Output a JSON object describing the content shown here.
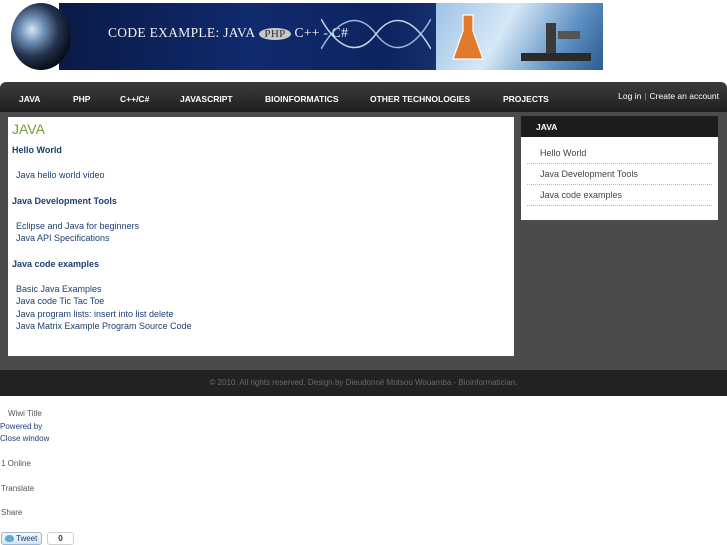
{
  "banner": {
    "title_prefix": "CODE EXAMPLE: JAVA",
    "title_pill": "PHP",
    "title_suffix": "C++ - C#"
  },
  "nav": {
    "items": [
      "JAVA",
      "PHP",
      "C++/C#",
      "JAVASCRIPT",
      "BIOINFORMATICS",
      "OTHER TECHNOLOGIES",
      "PROJECTS"
    ],
    "login": "Log in",
    "separator": "|",
    "create_account": "Create an account"
  },
  "main": {
    "heading": "JAVA",
    "sections": [
      {
        "title": "Hello World",
        "links": [
          "Java hello world video"
        ]
      },
      {
        "title": "Java Development Tools",
        "links": [
          "Eclipse and Java for beginners",
          "Java API Specifications"
        ]
      },
      {
        "title": "Java code examples",
        "links": [
          "Basic Java Examples",
          "Java code Tic Tac Toe",
          "Java program lists: insert into list delete",
          "Java Matrix Example Program Source Code"
        ]
      }
    ]
  },
  "sidebar": {
    "heading": "JAVA",
    "items": [
      "Hello World",
      "Java Development Tools",
      "Java code examples"
    ]
  },
  "footer": {
    "text": "© 2010. All rights reserved. Design by Dieudonné Motsou Wouamba - Bioinformatician."
  },
  "widgets": {
    "wiwi_title": "Wiwi Title",
    "powered_by": "Powered by",
    "close_window": "Close window",
    "online": "1 Online",
    "translate": "Translate",
    "share": "Share",
    "tweet_label": "Tweet",
    "tweet_count": "0"
  }
}
